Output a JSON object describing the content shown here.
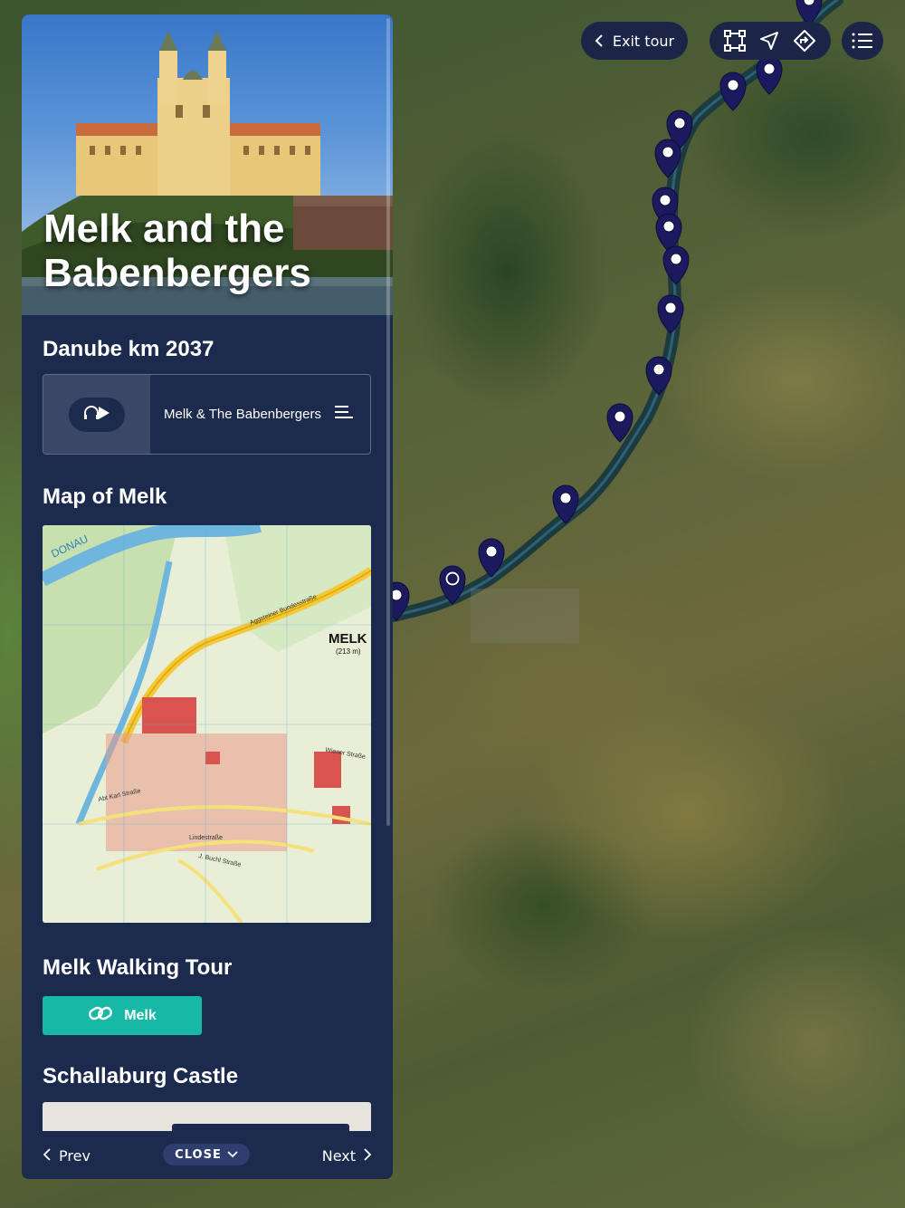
{
  "topbar": {
    "exit_label": "Exit tour",
    "tools": [
      "frame-icon",
      "navigate-icon",
      "directions-icon"
    ],
    "menu_icon": "list-icon"
  },
  "panel": {
    "hero_title": "Melk and the Babenbergers",
    "sections": {
      "audio_title": "Danube km 2037",
      "audio_track": "Melk & The Babenbergers",
      "map_title": "Map of Melk",
      "walking_title": "Melk Walking Tour",
      "walking_link": "Melk",
      "castle_title": "Schallaburg Castle"
    },
    "map": {
      "town": "MELK",
      "elevation": "(213 m)",
      "river": "DONAU",
      "streets": [
        "Aggsteiner Bundesstraße",
        "Wiener Straße",
        "Abt Karl Straße",
        "Lindestraße",
        "J. Buchl Straße"
      ]
    },
    "footer": {
      "prev": "Prev",
      "close": "CLOSE",
      "next": "Next"
    }
  },
  "colors": {
    "panel": "#1c2a4e",
    "accent": "#17b8a6",
    "pin": "#1c1a5e"
  }
}
